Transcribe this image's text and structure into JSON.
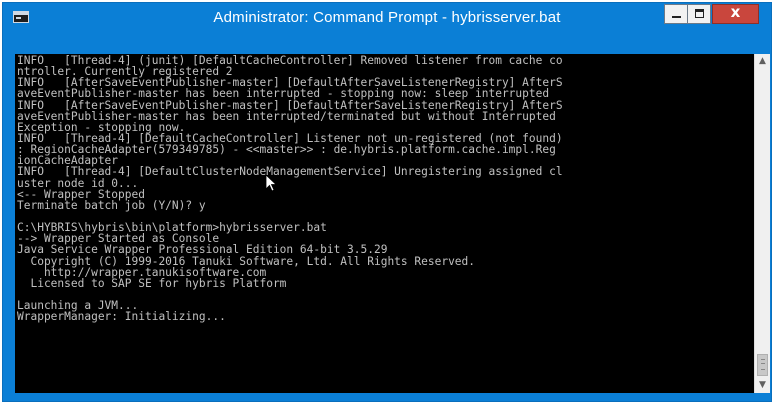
{
  "window": {
    "title": "Administrator: Command Prompt - hybrisserver.bat",
    "controls": {
      "minimize_icon": "minimize-icon",
      "maximize_icon": "maximize-icon",
      "close_label": "x"
    },
    "app_icon": "command-prompt-icon"
  },
  "console": {
    "lines": [
      "INFO   [Thread-4] (junit) [DefaultCacheController] Removed listener from cache co",
      "ntroller. Currently registered 2",
      "INFO   [AfterSaveEventPublisher-master] [DefaultAfterSaveListenerRegistry] AfterS",
      "aveEventPublisher-master has been interrupted - stopping now: sleep interrupted",
      "INFO   [AfterSaveEventPublisher-master] [DefaultAfterSaveListenerRegistry] AfterS",
      "aveEventPublisher-master has been interrupted/terminated but without Interrupted",
      "Exception - stopping now.",
      "INFO   [Thread-4] [DefaultCacheController] Listener not un-registered (not found)",
      ": RegionCacheAdapter(579349785) - <<master>> : de.hybris.platform.cache.impl.Reg",
      "ionCacheAdapter",
      "INFO   [Thread-4] [DefaultClusterNodeManagementService] Unregistering assigned cl",
      "uster node id 0...",
      "<-- Wrapper Stopped",
      "Terminate batch job (Y/N)? y",
      "",
      "C:\\HYBRIS\\hybris\\bin\\platform>hybrisserver.bat",
      "--> Wrapper Started as Console",
      "Java Service Wrapper Professional Edition 64-bit 3.5.29",
      "  Copyright (C) 1999-2016 Tanuki Software, Ltd. All Rights Reserved.",
      "    http://wrapper.tanukisoftware.com",
      "  Licensed to SAP SE for hybris Platform",
      "",
      "Launching a JVM...",
      "WrapperManager: Initializing..."
    ]
  },
  "scrollbar": {
    "up_icon": "scroll-up-arrow-icon",
    "down_icon": "scroll-down-arrow-icon"
  },
  "colors": {
    "titlebar": "#0b7fd6",
    "console_bg": "#000000",
    "console_text": "#c0c0c0",
    "close_button": "#c9463d"
  }
}
